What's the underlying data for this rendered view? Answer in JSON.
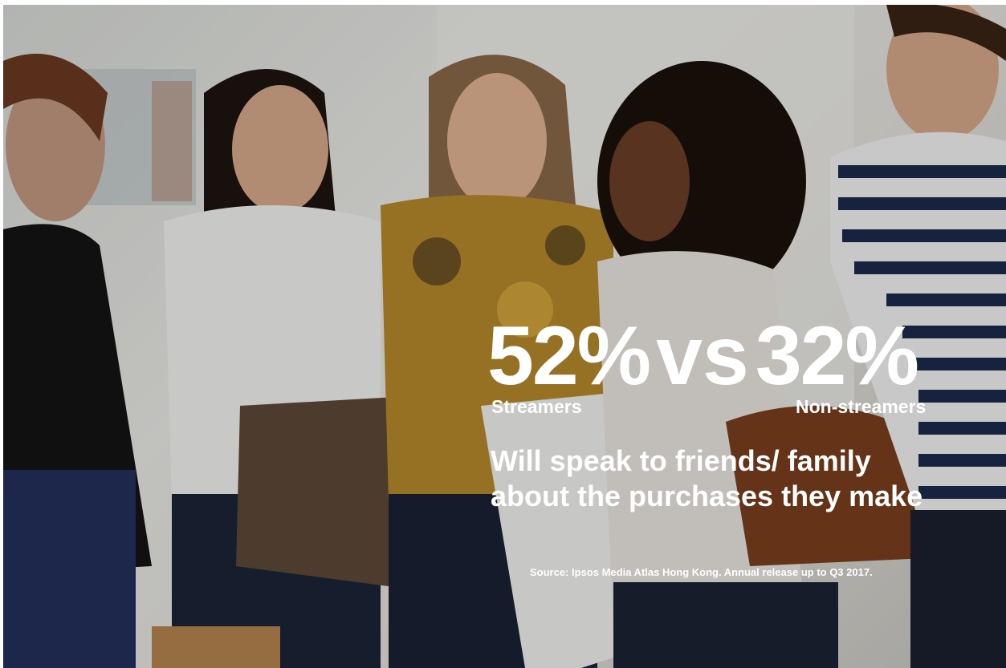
{
  "stat": {
    "streamers_value": "52%",
    "vs_text": "vs",
    "non_streamers_value": "32%",
    "streamers_label": "Streamers",
    "non_streamers_label": "Non-streamers"
  },
  "headline": {
    "line1": "Will speak to friends/ family",
    "line2": "about the purchases they make"
  },
  "source": "Source: Ipsos Media Atlas Hong Kong.  Annual release up to Q3 2017.",
  "colors": {
    "text": "#ffffff",
    "background": "#e6e4df"
  }
}
